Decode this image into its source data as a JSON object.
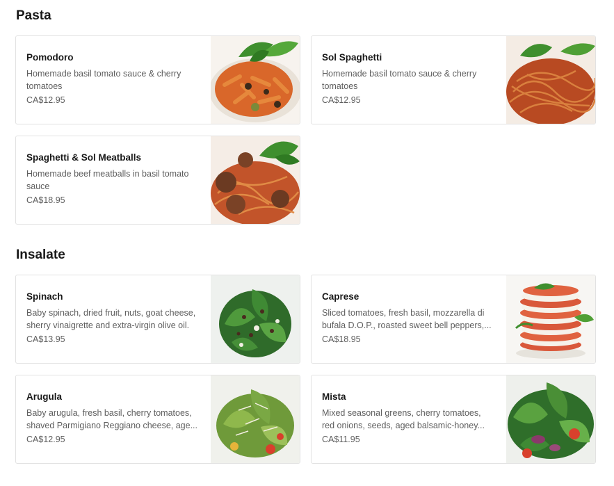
{
  "sections": [
    {
      "title": "Pasta",
      "items": [
        {
          "name": "Pomodoro",
          "description": "Homemade basil tomato sauce & cherry tomatoes",
          "price": "CA$12.95",
          "image": "penne-pomodoro-photo"
        },
        {
          "name": "Sol Spaghetti",
          "description": "Homemade basil tomato sauce & cherry tomatoes",
          "price": "CA$12.95",
          "image": "spaghetti-tomato-photo"
        },
        {
          "name": "Spaghetti & Sol Meatballs",
          "description": "Homemade beef meatballs in basil tomato sauce",
          "price": "CA$18.95",
          "image": "spaghetti-meatballs-photo"
        }
      ]
    },
    {
      "title": "Insalate",
      "items": [
        {
          "name": "Spinach",
          "description": "Baby spinach, dried fruit, nuts, goat cheese, sherry vinaigrette and extra-virgin olive oil.",
          "price": "CA$13.95",
          "image": "spinach-salad-photo"
        },
        {
          "name": "Caprese",
          "description": "Sliced tomatoes, fresh basil, mozzarella di bufala D.O.P., roasted sweet bell peppers,...",
          "price": "CA$18.95",
          "image": "caprese-stack-photo"
        },
        {
          "name": "Arugula",
          "description": "Baby arugula, fresh basil, cherry tomatoes, shaved Parmigiano Reggiano cheese, age...",
          "price": "CA$12.95",
          "image": "arugula-salad-photo"
        },
        {
          "name": "Mista",
          "description": "Mixed seasonal greens, cherry tomatoes, red onions, seeds, aged balsamic-honey...",
          "price": "CA$11.95",
          "image": "mixed-greens-photo"
        }
      ]
    }
  ]
}
